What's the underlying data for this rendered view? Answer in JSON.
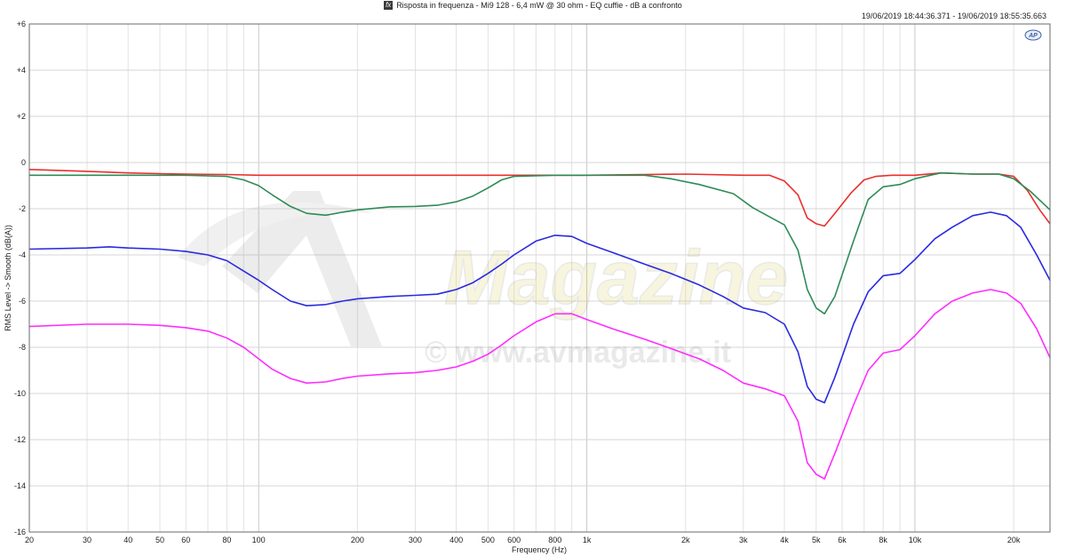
{
  "window": {
    "title": "Risposta in frequenza - Mi9 128 - 6,4 mW @ 30 ohm - EQ cuffie - dB a confronto",
    "timestamp": "19/06/2019 18:44:36.371 - 19/06/2019 18:55:35.663",
    "logo_text": "AP"
  },
  "watermark": {
    "brand": "Magazine",
    "url": "© www.avmagazine.it"
  },
  "colors": {
    "red": "#e8302c",
    "green": "#2e8b57",
    "blue": "#2a2ae0",
    "magenta": "#ff2cff"
  },
  "chart_data": {
    "type": "line",
    "xlabel": "Frequency (Hz)",
    "ylabel": "RMS Level -> Smooth (dB(A))",
    "x_scale": "log",
    "xlim": [
      20,
      20000
    ],
    "ylim": [
      -16,
      6
    ],
    "grid": true,
    "x_ticks": [
      20,
      30,
      40,
      50,
      60,
      80,
      100,
      200,
      300,
      400,
      500,
      600,
      800,
      1000,
      2000,
      3000,
      4000,
      5000,
      6000,
      8000,
      10000,
      20000
    ],
    "x_tick_labels": [
      "20",
      "30",
      "40",
      "50",
      "60",
      "80",
      "100",
      "200",
      "300",
      "400",
      "500",
      "600",
      "800",
      "1k",
      "2k",
      "3k",
      "4k",
      "5k",
      "6k",
      "8k",
      "10k",
      "20k"
    ],
    "y_ticks": [
      6,
      4,
      2,
      0,
      -2,
      -4,
      -6,
      -8,
      -10,
      -12,
      -14,
      -16
    ],
    "y_tick_labels": [
      "+6",
      "+4",
      "+2",
      "0",
      "-2",
      "-4",
      "-6",
      "-8",
      "-10",
      "-12",
      "-14",
      "-16"
    ],
    "series": [
      {
        "color": "#e8302c",
        "points": [
          [
            20,
            -0.3
          ],
          [
            30,
            -0.38
          ],
          [
            40,
            -0.45
          ],
          [
            50,
            -0.48
          ],
          [
            60,
            -0.5
          ],
          [
            80,
            -0.52
          ],
          [
            100,
            -0.55
          ],
          [
            200,
            -0.55
          ],
          [
            500,
            -0.55
          ],
          [
            1000,
            -0.55
          ],
          [
            2000,
            -0.5
          ],
          [
            3000,
            -0.55
          ],
          [
            3600,
            -0.55
          ],
          [
            4000,
            -0.8
          ],
          [
            4400,
            -1.4
          ],
          [
            4700,
            -2.4
          ],
          [
            5000,
            -2.65
          ],
          [
            5300,
            -2.75
          ],
          [
            5700,
            -2.2
          ],
          [
            6400,
            -1.3
          ],
          [
            7000,
            -0.75
          ],
          [
            7600,
            -0.6
          ],
          [
            8500,
            -0.55
          ],
          [
            10000,
            -0.55
          ],
          [
            12000,
            -0.45
          ],
          [
            15000,
            -0.5
          ],
          [
            18000,
            -0.5
          ],
          [
            20000,
            -0.6
          ],
          [
            22000,
            -1.2
          ],
          [
            24000,
            -2.05
          ],
          [
            25800,
            -2.65
          ]
        ]
      },
      {
        "color": "#2e8b57",
        "points": [
          [
            20,
            -0.55
          ],
          [
            40,
            -0.55
          ],
          [
            60,
            -0.55
          ],
          [
            80,
            -0.6
          ],
          [
            90,
            -0.75
          ],
          [
            100,
            -1.0
          ],
          [
            110,
            -1.4
          ],
          [
            125,
            -1.9
          ],
          [
            140,
            -2.2
          ],
          [
            160,
            -2.28
          ],
          [
            180,
            -2.15
          ],
          [
            200,
            -2.05
          ],
          [
            250,
            -1.92
          ],
          [
            300,
            -1.9
          ],
          [
            350,
            -1.85
          ],
          [
            400,
            -1.7
          ],
          [
            450,
            -1.45
          ],
          [
            500,
            -1.1
          ],
          [
            550,
            -0.75
          ],
          [
            600,
            -0.6
          ],
          [
            800,
            -0.55
          ],
          [
            1000,
            -0.55
          ],
          [
            1500,
            -0.55
          ],
          [
            1800,
            -0.7
          ],
          [
            2200,
            -0.95
          ],
          [
            2800,
            -1.35
          ],
          [
            3200,
            -1.95
          ],
          [
            3600,
            -2.35
          ],
          [
            4000,
            -2.7
          ],
          [
            4400,
            -3.8
          ],
          [
            4700,
            -5.5
          ],
          [
            5000,
            -6.3
          ],
          [
            5300,
            -6.55
          ],
          [
            5700,
            -5.8
          ],
          [
            6500,
            -3.4
          ],
          [
            7200,
            -1.6
          ],
          [
            8000,
            -1.05
          ],
          [
            9000,
            -0.95
          ],
          [
            10000,
            -0.7
          ],
          [
            12000,
            -0.45
          ],
          [
            15000,
            -0.5
          ],
          [
            18000,
            -0.5
          ],
          [
            20000,
            -0.7
          ],
          [
            22500,
            -1.25
          ],
          [
            25800,
            -2.05
          ]
        ]
      },
      {
        "color": "#2a2ae0",
        "points": [
          [
            20,
            -3.75
          ],
          [
            30,
            -3.7
          ],
          [
            35,
            -3.65
          ],
          [
            40,
            -3.7
          ],
          [
            50,
            -3.75
          ],
          [
            60,
            -3.85
          ],
          [
            70,
            -4.0
          ],
          [
            80,
            -4.25
          ],
          [
            90,
            -4.7
          ],
          [
            100,
            -5.1
          ],
          [
            110,
            -5.5
          ],
          [
            125,
            -6.0
          ],
          [
            140,
            -6.2
          ],
          [
            160,
            -6.15
          ],
          [
            180,
            -6.0
          ],
          [
            200,
            -5.9
          ],
          [
            250,
            -5.8
          ],
          [
            300,
            -5.75
          ],
          [
            350,
            -5.7
          ],
          [
            400,
            -5.5
          ],
          [
            450,
            -5.2
          ],
          [
            500,
            -4.8
          ],
          [
            550,
            -4.4
          ],
          [
            600,
            -4.0
          ],
          [
            700,
            -3.4
          ],
          [
            800,
            -3.15
          ],
          [
            900,
            -3.2
          ],
          [
            1000,
            -3.5
          ],
          [
            1200,
            -3.9
          ],
          [
            1500,
            -4.4
          ],
          [
            1800,
            -4.8
          ],
          [
            2200,
            -5.3
          ],
          [
            2600,
            -5.8
          ],
          [
            3000,
            -6.3
          ],
          [
            3500,
            -6.5
          ],
          [
            4000,
            -7.0
          ],
          [
            4400,
            -8.2
          ],
          [
            4700,
            -9.7
          ],
          [
            5000,
            -10.25
          ],
          [
            5300,
            -10.4
          ],
          [
            5700,
            -9.3
          ],
          [
            6500,
            -7.0
          ],
          [
            7200,
            -5.6
          ],
          [
            8000,
            -4.9
          ],
          [
            9000,
            -4.8
          ],
          [
            10000,
            -4.2
          ],
          [
            11500,
            -3.3
          ],
          [
            13000,
            -2.8
          ],
          [
            15000,
            -2.3
          ],
          [
            17000,
            -2.15
          ],
          [
            19000,
            -2.3
          ],
          [
            21000,
            -2.8
          ],
          [
            23500,
            -4.0
          ],
          [
            25800,
            -5.1
          ]
        ]
      },
      {
        "color": "#ff2cff",
        "points": [
          [
            20,
            -7.1
          ],
          [
            30,
            -7.0
          ],
          [
            40,
            -7.0
          ],
          [
            50,
            -7.05
          ],
          [
            60,
            -7.15
          ],
          [
            70,
            -7.3
          ],
          [
            80,
            -7.6
          ],
          [
            90,
            -8.0
          ],
          [
            100,
            -8.5
          ],
          [
            110,
            -8.95
          ],
          [
            125,
            -9.35
          ],
          [
            140,
            -9.55
          ],
          [
            160,
            -9.5
          ],
          [
            180,
            -9.35
          ],
          [
            200,
            -9.25
          ],
          [
            250,
            -9.15
          ],
          [
            300,
            -9.1
          ],
          [
            350,
            -9.0
          ],
          [
            400,
            -8.85
          ],
          [
            450,
            -8.6
          ],
          [
            500,
            -8.3
          ],
          [
            550,
            -7.9
          ],
          [
            600,
            -7.5
          ],
          [
            700,
            -6.9
          ],
          [
            800,
            -6.55
          ],
          [
            900,
            -6.55
          ],
          [
            1000,
            -6.8
          ],
          [
            1200,
            -7.2
          ],
          [
            1500,
            -7.65
          ],
          [
            1800,
            -8.05
          ],
          [
            2200,
            -8.5
          ],
          [
            2600,
            -9.0
          ],
          [
            3000,
            -9.55
          ],
          [
            3500,
            -9.8
          ],
          [
            4000,
            -10.1
          ],
          [
            4400,
            -11.2
          ],
          [
            4700,
            -13.0
          ],
          [
            5000,
            -13.5
          ],
          [
            5300,
            -13.7
          ],
          [
            5700,
            -12.6
          ],
          [
            6500,
            -10.5
          ],
          [
            7200,
            -9.0
          ],
          [
            8000,
            -8.25
          ],
          [
            9000,
            -8.1
          ],
          [
            10000,
            -7.5
          ],
          [
            11500,
            -6.55
          ],
          [
            13000,
            -6.0
          ],
          [
            15000,
            -5.65
          ],
          [
            17000,
            -5.5
          ],
          [
            19000,
            -5.65
          ],
          [
            21000,
            -6.1
          ],
          [
            23500,
            -7.2
          ],
          [
            25800,
            -8.45
          ]
        ]
      }
    ]
  }
}
